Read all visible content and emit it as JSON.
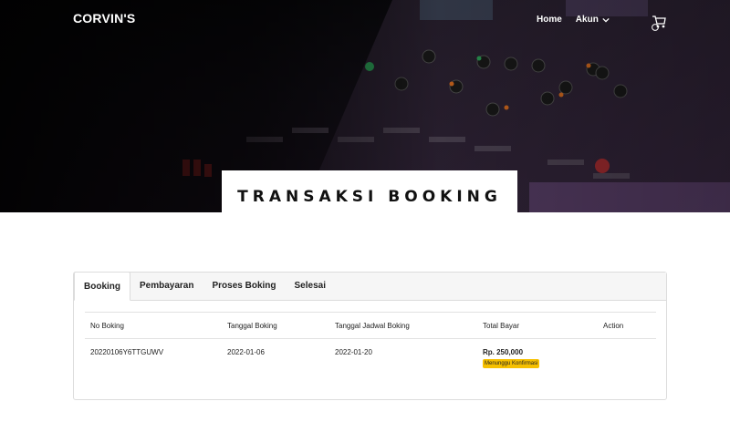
{
  "header": {
    "brand": "CORVIN'S",
    "nav": {
      "home": "Home",
      "account": "Akun"
    },
    "cart_icon": "cart-icon"
  },
  "hero": {
    "title": "TRANSAKSI BOOKING"
  },
  "tabs": [
    {
      "label": "Booking",
      "active": true
    },
    {
      "label": "Pembayaran",
      "active": false
    },
    {
      "label": "Proses Boking",
      "active": false
    },
    {
      "label": "Selesai",
      "active": false
    }
  ],
  "table": {
    "headers": [
      "No Boking",
      "Tanggal Boking",
      "Tanggal Jadwal Boking",
      "Total Bayar",
      "Action"
    ],
    "rows": [
      {
        "no_boking": "20220106Y6TTGUWV",
        "tanggal_boking": "2022-01-06",
        "tanggal_jadwal": "2022-01-20",
        "total_bayar": "Rp. 250,000",
        "status": "Menunggu Konfirmasi"
      }
    ]
  },
  "colors": {
    "badge": "#f6c000",
    "hero_dark": "#0b0a0e"
  }
}
